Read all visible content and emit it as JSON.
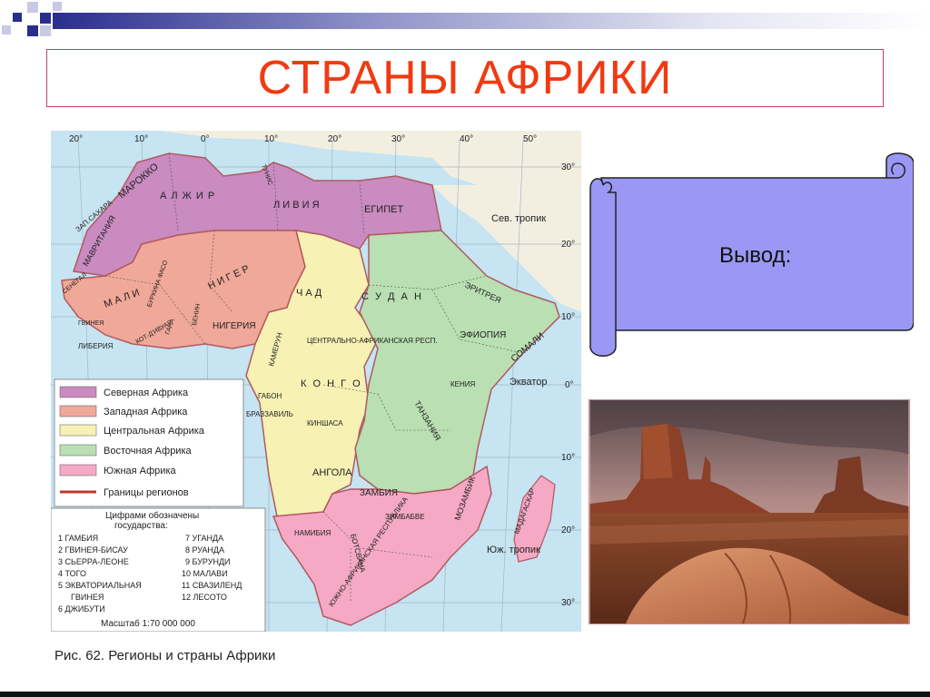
{
  "slide": {
    "title": "СТРАНЫ АФРИКИ",
    "conclusion_label": "Вывод:",
    "caption": "Рис. 62. Регионы и страны Африки"
  },
  "map": {
    "legend": [
      {
        "label": "Северная Африка",
        "color": "#c98bc0"
      },
      {
        "label": "Западная Африка",
        "color": "#f0a898"
      },
      {
        "label": "Центральная Африка",
        "color": "#f7f1b4"
      },
      {
        "label": "Восточная Африка",
        "color": "#b9dfb2"
      },
      {
        "label": "Южная Африка",
        "color": "#f5a9c4"
      }
    ],
    "border_label": "Границы регионов",
    "numbers_title_1": "Цифрами обозначены",
    "numbers_title_2": "государства:",
    "numbered_states": [
      "1 ГАМБИЯ",
      "2 ГВИНЕЯ-БИСАУ",
      "3 СЬЕРРА-ЛЕОНЕ",
      "4 ТОГО",
      "5 ЭКВАТОРИАЛЬНАЯ",
      "ГВИНЕЯ",
      "6 ДЖИБУТИ",
      "7 УГАНДА",
      "8 РУАНДА",
      "9 БУРУНДИ",
      "10 МАЛАВИ",
      "11 СВАЗИЛЕНД",
      "12 ЛЕСОТО"
    ],
    "scale": "Масштаб 1:70 000 000",
    "lines": [
      "Сев. тропик",
      "Экватор",
      "Юж. тропик"
    ],
    "countries": [
      "МАРОККО",
      "А Л Ж И Р",
      "Л И В И Я",
      "ЕГИПЕТ",
      "ЗАП.САХАРА",
      "МАВРИТАНИЯ",
      "М А Л И",
      "Н И Г Е Р",
      "Ч А Д",
      "С У Д А Н",
      "ЭРИТРЕЯ",
      "ЭФИОПИЯ",
      "СОМАЛИ",
      "НИГЕРИЯ",
      "ЛИБЕРИЯ",
      "КАМЕРУН",
      "ЦЕНТРАЛЬНО-АФРИКАНСКАЯ РЕСП.",
      "К О Н Г О",
      "ГАБОН",
      "БРАЗЗАВИЛЬ",
      "КИНШАСА",
      "КЕНИЯ",
      "ТАНЗАНИЯ",
      "АНГОЛА",
      "ЗАМБИЯ",
      "ЗИМБАБВЕ",
      "МОЗАМБИК",
      "НАМИБИЯ",
      "БОТСВАНА",
      "ЮЖНО-АФРИКАНСКАЯ РЕСПУБЛИКА",
      "МАДАГАСКАР",
      "СЕНЕГАЛ",
      "ГВИНЕЯ",
      "БУРКИНА ФАСО",
      "КОТ-Д'ИВУАР",
      "ГАНА",
      "БЕНИН",
      "ТУНИС"
    ],
    "grid_labels_top": [
      "20°",
      "10°",
      "0°",
      "10°",
      "20°",
      "30°",
      "40°",
      "50°"
    ],
    "grid_labels_right": [
      "30°",
      "20°",
      "10°",
      "0°",
      "10°",
      "20°",
      "30°"
    ]
  },
  "photo": {
    "subject": "desert-buttes"
  }
}
